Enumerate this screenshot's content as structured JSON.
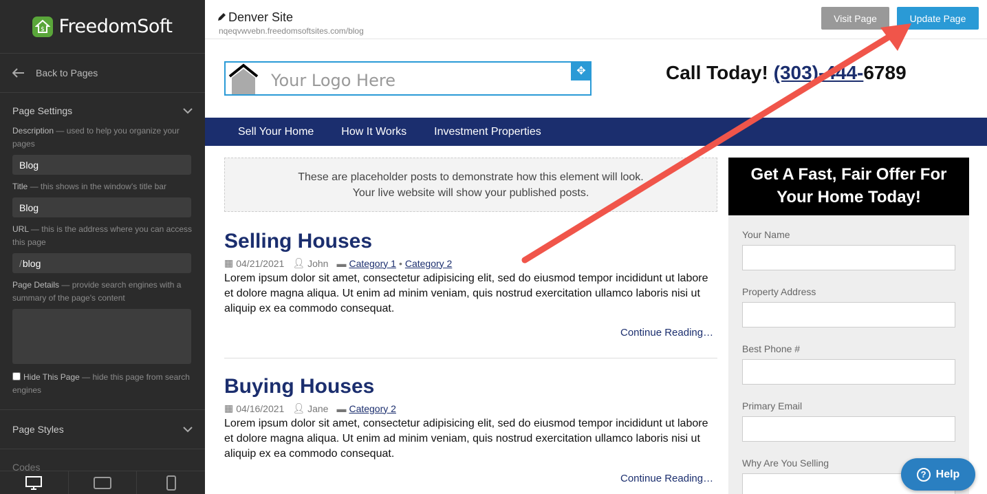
{
  "sidebar": {
    "brand": "FreedomSoft",
    "back_label": "Back to Pages",
    "page_settings": {
      "title": "Page Settings",
      "description_label": "Description",
      "description_help": "— used to help you organize your pages",
      "description_value": "Blog",
      "title_label": "Title",
      "title_help": "— this shows in the window's title bar",
      "title_value": "Blog",
      "url_label": "URL",
      "url_help": "— this is the address where you can access this page",
      "url_prefix": "/",
      "url_value": "blog",
      "details_label": "Page Details",
      "details_help": "— provide search engines with a summary of the page's content",
      "hide_label": "Hide This Page",
      "hide_help": "— hide this page from search engines"
    },
    "page_styles": "Page Styles",
    "codes": "Codes"
  },
  "topbar": {
    "site_name": "Denver Site",
    "site_url": "nqeqvwvebn.freedomsoftsites.com/blog",
    "visit_label": "Visit Page",
    "update_label": "Update Page"
  },
  "preview": {
    "logo_placeholder": "Your Logo Here",
    "call_text": "Call Today!",
    "phone_area": "(303)-444-",
    "phone_rest": "6789",
    "nav": [
      "Sell Your Home",
      "How It Works",
      "Investment Properties"
    ],
    "placeholder_line1": "These are placeholder posts to demonstrate how this element will look.",
    "placeholder_line2": "Your live website will show your published posts.",
    "posts": [
      {
        "title": "Selling Houses",
        "date": "04/21/2021",
        "author": "John",
        "category1": "Category 1",
        "category2": "Category 2",
        "body": "Lorem ipsum dolor sit amet, consectetur adipisicing elit, sed do eiusmod tempor incididunt ut labore et dolore magna aliqua. Ut enim ad minim veniam, quis nostrud exercitation ullamco laboris nisi ut aliquip ex ea commodo consequat.",
        "continue": "Continue Reading…"
      },
      {
        "title": "Buying Houses",
        "date": "04/16/2021",
        "author": "Jane",
        "category1": "Category 2",
        "body": "Lorem ipsum dolor sit amet, consectetur adipisicing elit, sed do eiusmod tempor incididunt ut labore et dolore magna aliqua. Ut enim ad minim veniam, quis nostrud exercitation ullamco laboris nisi ut aliquip ex ea commodo consequat.",
        "continue": "Continue Reading…"
      }
    ],
    "form_title_line1": "Get A Fast, Fair Offer For",
    "form_title_line2": "Your Home Today!",
    "form_fields": [
      "Your Name",
      "Property Address",
      "Best Phone #",
      "Primary Email",
      "Why Are You Selling"
    ]
  },
  "help_label": "Help",
  "colors": {
    "accent": "#2a9ad6",
    "nav": "#1b2e6e",
    "annotation_arrow": "#f0554a"
  }
}
